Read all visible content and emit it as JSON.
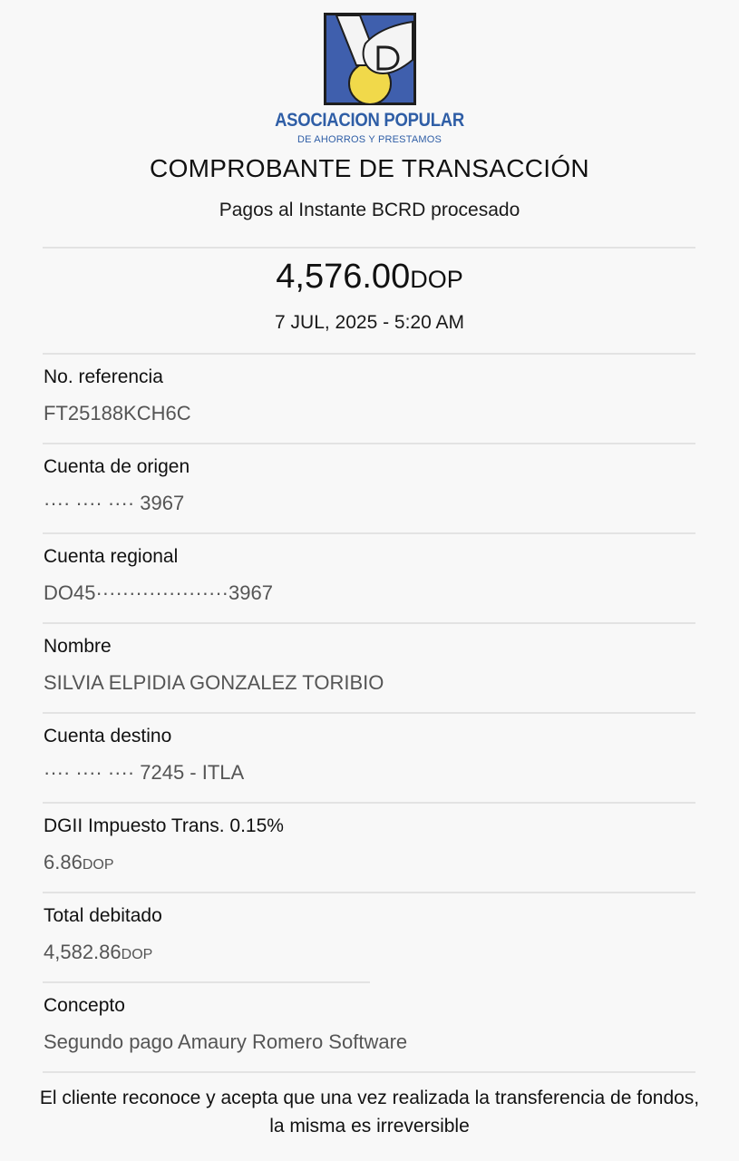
{
  "brand": {
    "name": "ASOCIACION POPULAR",
    "tagline": "DE AHORROS Y PRESTAMOS",
    "logo_icon": "apap-hand-coin-logo",
    "colors": {
      "blue": "#2f5ea6",
      "yellow": "#f1d94a",
      "frame": "#1e1e1e"
    }
  },
  "receipt": {
    "title": "COMPROBANTE DE TRANSACCIÓN",
    "subtitle": "Pagos al Instante BCRD procesado",
    "amount": "4,576.00",
    "currency": "DOP",
    "datetime": "7 JUL, 2025 - 5:20 AM"
  },
  "details": [
    {
      "label": "No. referencia",
      "value": "FT25188KCH6C"
    },
    {
      "label": "Cuenta de origen",
      "value": "···· ···· ···· 3967"
    },
    {
      "label": "Cuenta regional",
      "value": "DO45····················3967"
    },
    {
      "label": "Nombre",
      "value": "SILVIA ELPIDIA GONZALEZ TORIBIO"
    },
    {
      "label": "Cuenta destino",
      "value": "···· ···· ···· 7245 - ITLA"
    },
    {
      "label": "DGII Impuesto Trans. 0.15%",
      "value": "6.86",
      "currency": "DOP"
    },
    {
      "label": "Total debitado",
      "value": "4,582.86",
      "currency": "DOP"
    },
    {
      "label": "Concepto",
      "value": "Segundo pago Amaury Romero Software"
    }
  ],
  "footer": {
    "note": "El cliente reconoce y acepta que una vez realizada la transferencia de fondos, la misma es irreversible"
  }
}
